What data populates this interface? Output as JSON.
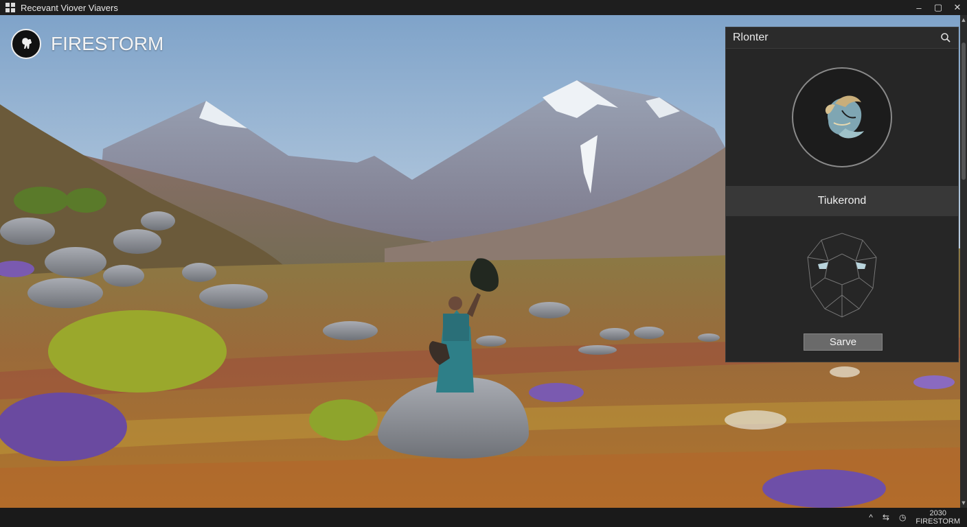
{
  "window": {
    "title": "Recevant Viover Viavers",
    "minimize_glyph": "–",
    "maximize_glyph": "▢",
    "close_glyph": "✕"
  },
  "brand": {
    "name": "FIRESTORM",
    "logo_icon": "firestorm-logo-icon"
  },
  "panel": {
    "title": "Rlonter",
    "search_icon": "search-icon",
    "avatar_icon": "feather-emblem-icon",
    "name_label": "Tiukerond",
    "mask_icon": "face-mask-icon",
    "save_label": "Sarve"
  },
  "taskbar": {
    "tray_up_glyph": "^",
    "tray_net_glyph": "⇆",
    "tray_clock_glyph": "◷",
    "clock_time": "2030",
    "clock_label": "FIRESTORM"
  },
  "colors": {
    "panel_bg": "#262626",
    "panel_header_bg": "#2b2b2b",
    "label_row_bg": "#383838",
    "save_button_bg": "#6a6a6a",
    "taskbar_bg": "#1a1a1a"
  }
}
